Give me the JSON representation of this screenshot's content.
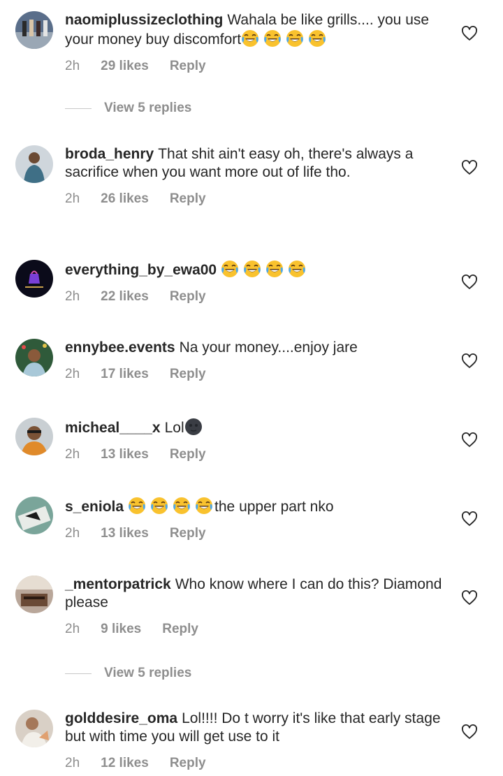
{
  "comments": [
    {
      "username": "naomiplussizeclothing",
      "text": "Wahala be like grills.... you use your money buy discomfort",
      "emoji_after": 4,
      "time": "2h",
      "likes": "29 likes",
      "reply": "Reply",
      "view_replies": "View 5 replies"
    },
    {
      "username": "broda_henry",
      "text": "That shit ain't easy oh, there's always a sacrifice when you want more out of life tho.",
      "time": "2h",
      "likes": "26 likes",
      "reply": "Reply"
    },
    {
      "username": "everything_by_ewa00",
      "text": "",
      "emoji_after": 4,
      "time": "2h",
      "likes": "22 likes",
      "reply": "Reply"
    },
    {
      "username": "ennybee.events",
      "text": "Na your money....enjoy jare",
      "time": "2h",
      "likes": "17 likes",
      "reply": "Reply"
    },
    {
      "username": "micheal____x",
      "text": "Lol",
      "time": "2h",
      "likes": "13 likes",
      "reply": "Reply"
    },
    {
      "username": "s_eniola",
      "text": "the upper part nko",
      "time": "2h",
      "likes": "13 likes",
      "reply": "Reply"
    },
    {
      "username": "_mentorpatrick",
      "text": "Who know where I can do this? Diamond please",
      "time": "2h",
      "likes": "9 likes",
      "reply": "Reply",
      "view_replies": "View 5 replies"
    },
    {
      "username": "golddesire_oma",
      "text": "Lol!!!! Do t worry it's like that early stage but with time you will get use to it",
      "time": "2h",
      "likes": "12 likes",
      "reply": "Reply"
    }
  ],
  "icons": {
    "like": "heart-outline-icon",
    "laugh": "face-with-tears-of-joy-emoji",
    "moon": "new-moon-face-emoji"
  },
  "colors": {
    "text": "#262626",
    "meta": "#8e8e8e",
    "divider": "#c7c7c7"
  }
}
